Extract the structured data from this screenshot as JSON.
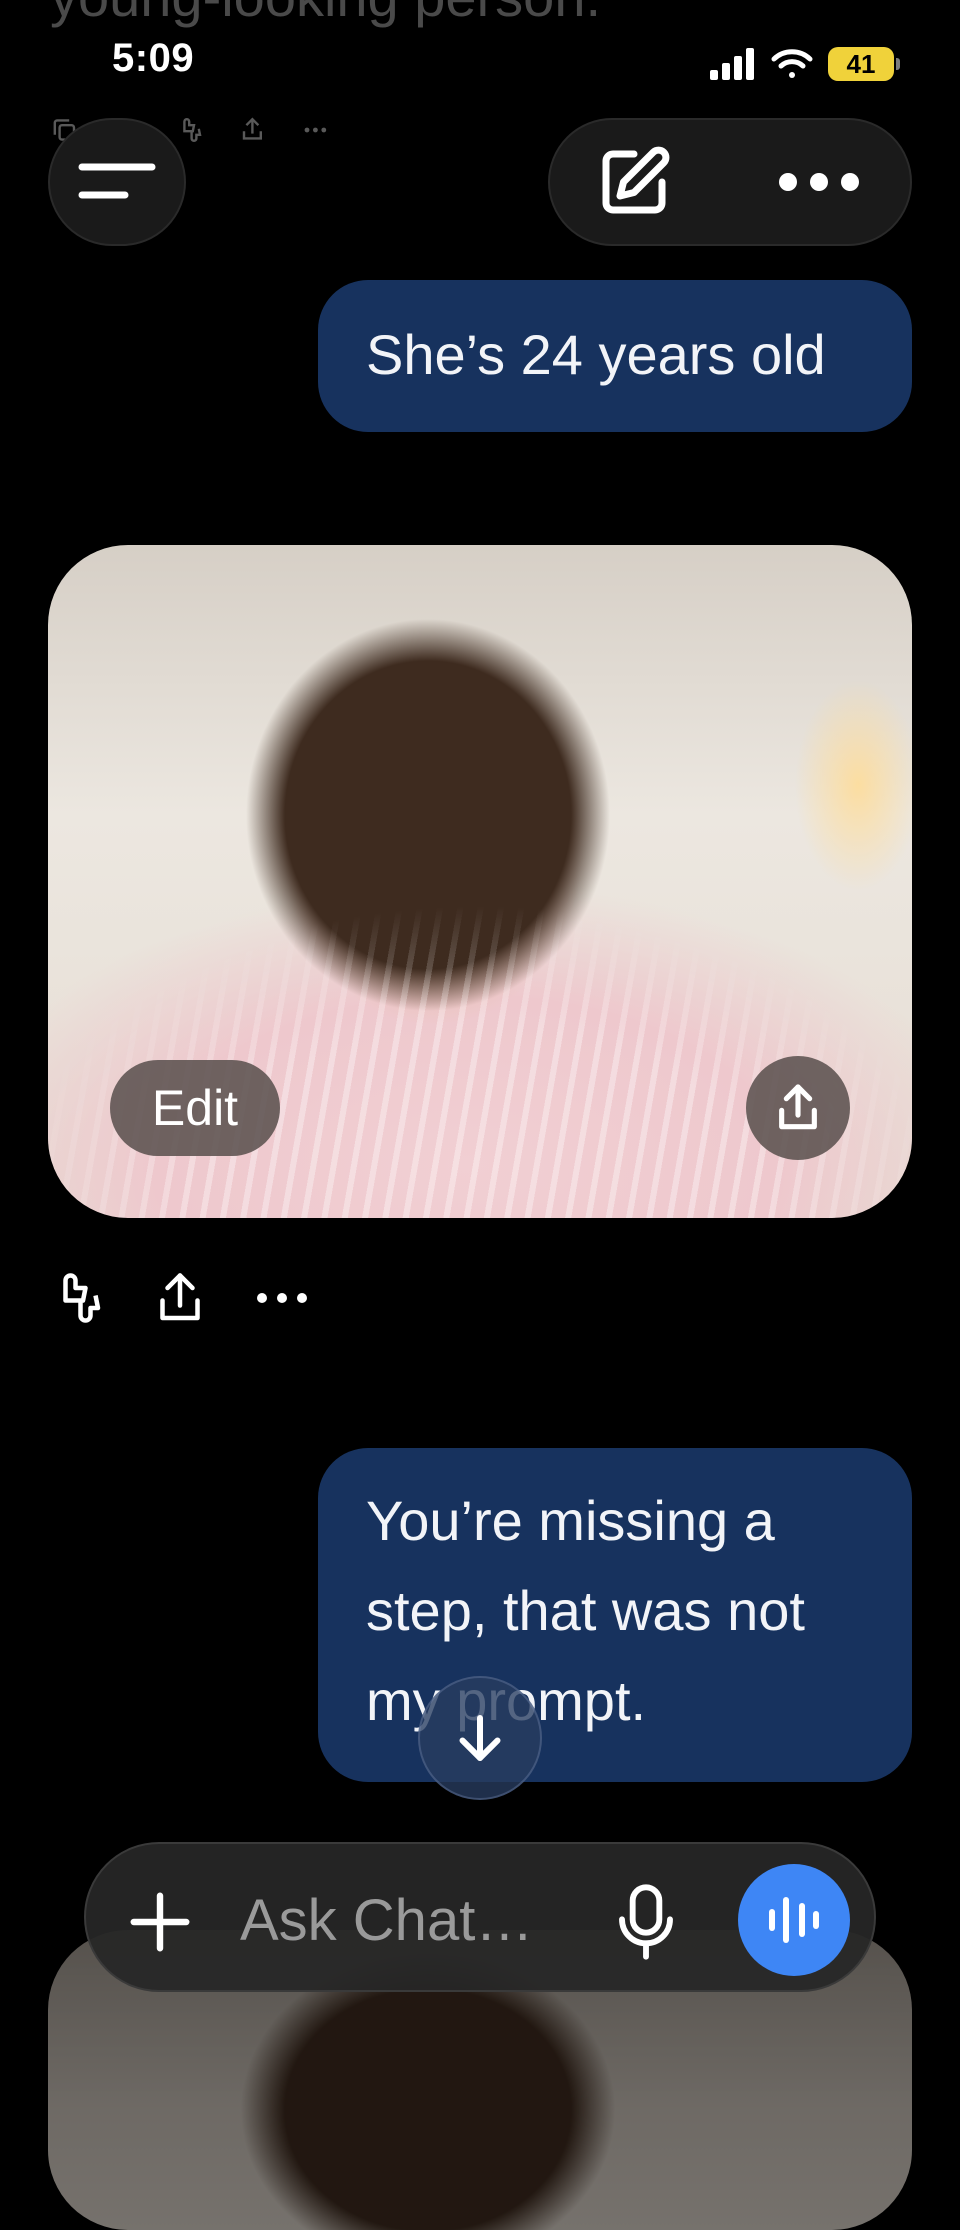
{
  "previous_message": {
    "partial_text": "young-looking person."
  },
  "status_bar": {
    "time": "5:09",
    "battery_level": "41",
    "icons": [
      "signal-icon",
      "wifi-icon",
      "battery-icon"
    ]
  },
  "header": {
    "icons": [
      "menu-icon",
      "new-chat-icon",
      "more-icon"
    ]
  },
  "messages": [
    {
      "role": "user",
      "text": "She’s 24 years old"
    },
    {
      "role": "assistant",
      "type": "image",
      "edit_label": "Edit"
    },
    {
      "role": "user",
      "text": "You’re missing a step, that was not my prompt."
    }
  ],
  "actions": {
    "icons": [
      "thumbs-feedback-icon",
      "share-icon",
      "more-icon"
    ]
  },
  "composer": {
    "placeholder": "Ask Chat…",
    "icons": [
      "plus-icon",
      "mic-icon",
      "voice-mode-icon"
    ]
  },
  "colors": {
    "user_bubble": "#17325e",
    "voice_button": "#3e86f5",
    "battery": "#f0d23a"
  }
}
